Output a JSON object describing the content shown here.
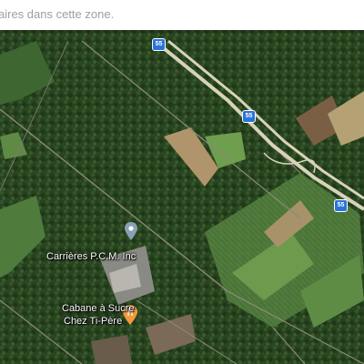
{
  "topbar": {
    "message": "aires dans cette zone."
  },
  "map": {
    "imagery": "satellite",
    "highway_color": "#d8d3b8",
    "route_shields": [
      {
        "number": "55"
      },
      {
        "number": "55"
      },
      {
        "number": "55"
      }
    ],
    "places": [
      {
        "name": "Carrières P.C.M. Inc",
        "category": "business",
        "icon": "map-pin-icon",
        "color": "#8aa0b8"
      },
      {
        "name_line1": "Cabane à Sucre",
        "name_line2": "Chez Ti-Père",
        "category": "restaurant",
        "icon": "fork-knife-icon",
        "color": "#f29a3c"
      }
    ]
  }
}
